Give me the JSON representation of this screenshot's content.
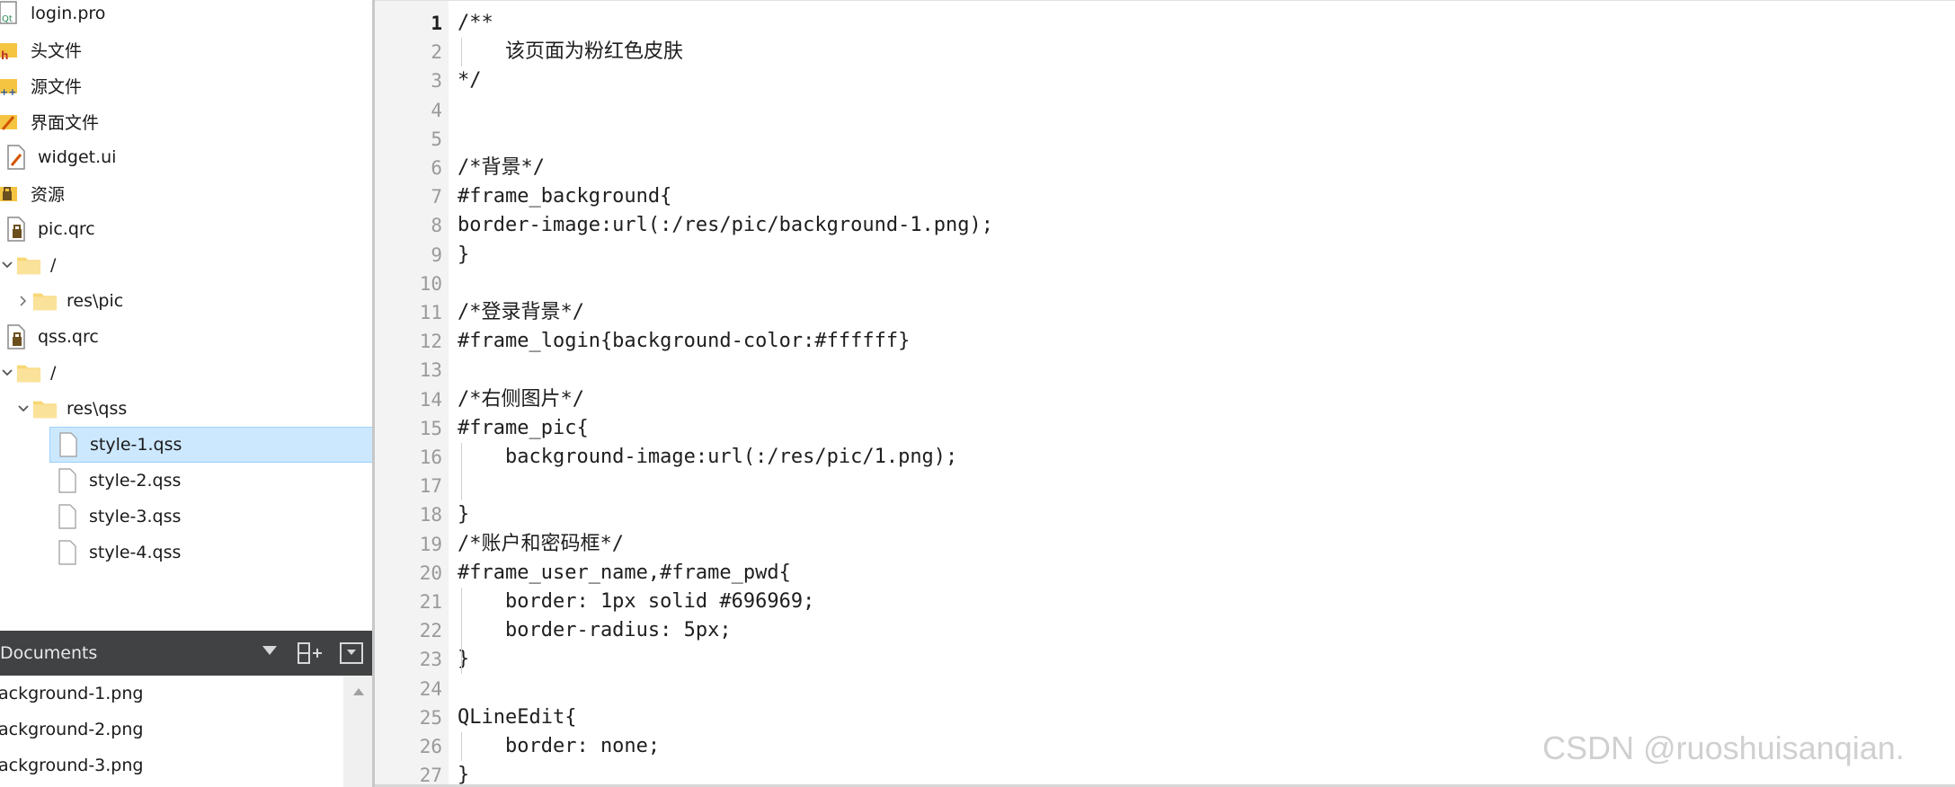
{
  "project_tree": {
    "items": [
      {
        "label": "login.pro",
        "icon": "pro-file-icon"
      },
      {
        "label": "头文件",
        "icon": "header-folder-icon"
      },
      {
        "label": "源文件",
        "icon": "source-folder-icon"
      },
      {
        "label": "界面文件",
        "icon": "form-folder-icon"
      },
      {
        "label": "widget.ui",
        "icon": "ui-file-icon"
      },
      {
        "label": "资源",
        "icon": "resource-folder-icon"
      },
      {
        "label": "pic.qrc",
        "icon": "qrc-file-icon"
      },
      {
        "label": "/",
        "icon": "folder-icon"
      },
      {
        "label": "res\\pic",
        "icon": "folder-icon"
      },
      {
        "label": "qss.qrc",
        "icon": "qrc-file-icon"
      },
      {
        "label": "/",
        "icon": "folder-icon"
      },
      {
        "label": "res\\qss",
        "icon": "folder-icon"
      },
      {
        "label": "style-1.qss",
        "icon": "file-icon"
      },
      {
        "label": "style-2.qss",
        "icon": "file-icon"
      },
      {
        "label": "style-3.qss",
        "icon": "file-icon"
      },
      {
        "label": "style-4.qss",
        "icon": "file-icon"
      }
    ]
  },
  "open_documents": {
    "title": "Documents",
    "items": [
      "ackground-1.png",
      "ackground-2.png",
      "ackground-3.png"
    ]
  },
  "editor": {
    "lines": [
      "/**",
      "    该页面为粉红色皮肤",
      "*/",
      "",
      "",
      "/*背景*/",
      "#frame_background{",
      "border-image:url(:/res/pic/background-1.png);",
      "}",
      "",
      "/*登录背景*/",
      "#frame_login{background-color:#ffffff}",
      "",
      "/*右侧图片*/",
      "#frame_pic{",
      "    background-image:url(:/res/pic/1.png);",
      "",
      "}",
      "/*账户和密码框*/",
      "#frame_user_name,#frame_pwd{",
      "    border: 1px solid #696969;",
      "    border-radius: 5px;",
      "}",
      "",
      "QLineEdit{",
      "    border: none;",
      "}"
    ],
    "line_numbers": [
      "1",
      "2",
      "3",
      "4",
      "5",
      "6",
      "7",
      "8",
      "9",
      "10",
      "11",
      "12",
      "13",
      "14",
      "15",
      "16",
      "17",
      "18",
      "19",
      "20",
      "21",
      "22",
      "23",
      "24",
      "25",
      "26",
      "27"
    ]
  },
  "watermark": "CSDN @ruoshuisanqian."
}
